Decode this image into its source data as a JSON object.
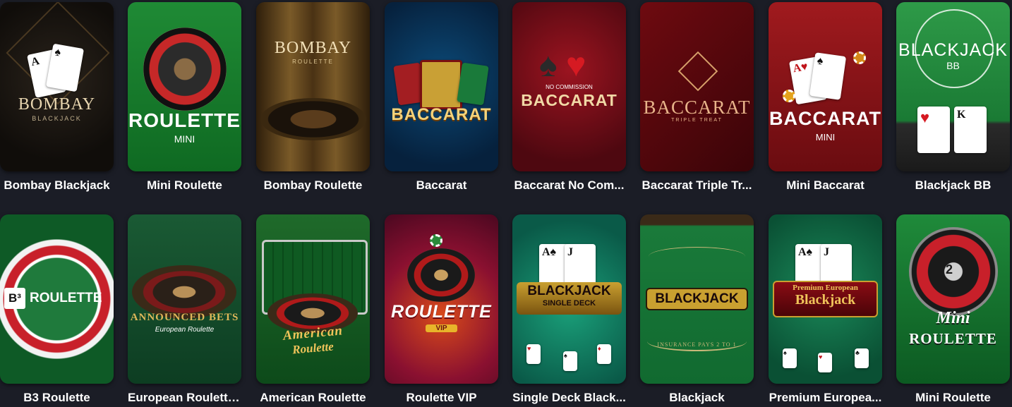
{
  "games": [
    {
      "title": "Bombay Blackjack",
      "logo": "BOMBAY",
      "sub": "BLACKJACK"
    },
    {
      "title": "Mini Roulette",
      "logo": "ROULETTE",
      "sub": "MINI"
    },
    {
      "title": "Bombay Roulette",
      "logo": "BOMBAY",
      "sub": "ROULETTE"
    },
    {
      "title": "Baccarat",
      "logo": "BACCARAT",
      "sub": ""
    },
    {
      "title": "Baccarat No Com...",
      "logo": "BACCARAT",
      "sub": "NO COMMISSION"
    },
    {
      "title": "Baccarat Triple Tr...",
      "logo": "BACCARAT",
      "sub": "TRIPLE TREAT"
    },
    {
      "title": "Mini Baccarat",
      "logo": "BACCARAT",
      "sub": "MINI"
    },
    {
      "title": "Blackjack BB",
      "logo": "BLACKJACK",
      "sub": "BB"
    },
    {
      "title": "B3 Roulette",
      "logo": "ROULETTE",
      "sub": "B³"
    },
    {
      "title": "European Roulette...",
      "logo": "ANNOUNCED BETS",
      "sub": "European Roulette"
    },
    {
      "title": "American Roulette",
      "logo": "American",
      "sub": "Roulette"
    },
    {
      "title": "Roulette VIP",
      "logo": "ROULETTE",
      "sub": "VIP"
    },
    {
      "title": "Single Deck Black...",
      "logo": "BLACKJACK",
      "sub": "SINGLE DECK"
    },
    {
      "title": "Blackjack",
      "logo": "BLACKJACK",
      "sub": "INSURANCE PAYS 2 TO 1"
    },
    {
      "title": "Premium Europea...",
      "logo": "Blackjack",
      "sub": "Premium European"
    },
    {
      "title": "Mini Roulette",
      "logo": "ROULETTE",
      "sub": "Mini"
    }
  ],
  "colors": {
    "page_bg": "#1b1d26",
    "caption": "#ffffff"
  }
}
